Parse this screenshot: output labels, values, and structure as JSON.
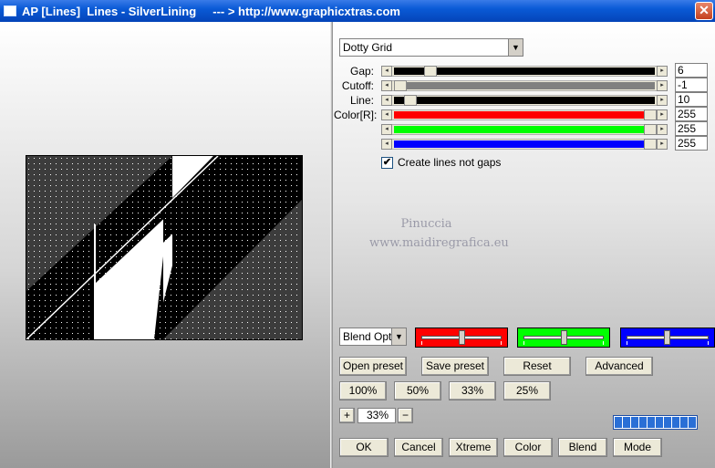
{
  "window": {
    "title": "AP [Lines]  Lines - SilverLining     --- > http://www.graphicxtras.com",
    "close_label": "✕"
  },
  "pattern_select": {
    "value": "Dotty Grid",
    "arrow": "▼"
  },
  "sliders": [
    {
      "label": "Gap:",
      "value": "6",
      "fraction": 0.12,
      "fill": "#000000"
    },
    {
      "label": "Cutoff:",
      "value": "-1",
      "fraction": 0.0,
      "fill": "#808080"
    },
    {
      "label": "Line:",
      "value": "10",
      "fraction": 0.04,
      "fill": "#000000"
    },
    {
      "label": "Color[R]:",
      "value": "255",
      "fraction": 1.0,
      "fill": "#ff0000"
    },
    {
      "label": "",
      "value": "255",
      "fraction": 1.0,
      "fill": "#00ff00"
    },
    {
      "label": "",
      "value": "255",
      "fraction": 1.0,
      "fill": "#0000ff"
    }
  ],
  "create_lines_checkbox": {
    "label": "Create lines not gaps",
    "checked": true,
    "mark": "✔"
  },
  "watermark": {
    "line1": "Pinuccia",
    "line2": "www.maidiregrafica.eu"
  },
  "blend_select": {
    "value": "Blend Optio",
    "arrow": "▼"
  },
  "color_boxes": [
    {
      "color": "#ff0000",
      "knob": 0.5
    },
    {
      "color": "#00ff00",
      "knob": 0.5
    },
    {
      "color": "#0000ff",
      "knob": 0.5
    }
  ],
  "buttons": {
    "open_preset": "Open preset",
    "save_preset": "Save preset",
    "reset": "Reset",
    "advanced": "Advanced",
    "zoom_100": "100%",
    "zoom_50": "50%",
    "zoom_33": "33%",
    "zoom_25": "25%",
    "zoom_in": "+",
    "zoom_out": "−",
    "ok": "OK",
    "cancel": "Cancel",
    "xtreme": "Xtreme",
    "color": "Color",
    "blend": "Blend",
    "mode": "Mode"
  },
  "zoom_value": "33%",
  "progress_segments": 10
}
